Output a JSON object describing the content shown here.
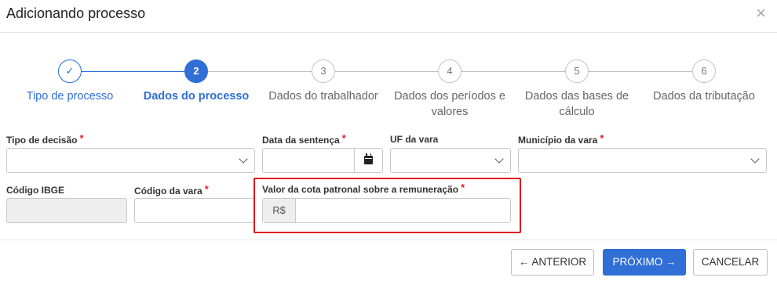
{
  "dialog": {
    "title": "Adicionando processo",
    "close_glyph": "×"
  },
  "steps": [
    {
      "number": "✓",
      "label": "Tipo de processo",
      "state": "done"
    },
    {
      "number": "2",
      "label": "Dados do processo",
      "state": "active"
    },
    {
      "number": "3",
      "label": "Dados do trabalhador",
      "state": "pending"
    },
    {
      "number": "4",
      "label": "Dados dos períodos e valores",
      "state": "pending"
    },
    {
      "number": "5",
      "label": "Dados das bases de cálculo",
      "state": "pending"
    },
    {
      "number": "6",
      "label": "Dados da tributação",
      "state": "pending"
    }
  ],
  "form": {
    "tipo_decisao": {
      "label": "Tipo de decisão",
      "required": "*",
      "value": ""
    },
    "data_sentenca": {
      "label": "Data da sentença",
      "required": "*",
      "value": ""
    },
    "uf_vara": {
      "label": "UF da vara",
      "value": ""
    },
    "municipio_vara": {
      "label": "Município da vara",
      "required": "*",
      "value": ""
    },
    "codigo_ibge": {
      "label": "Código IBGE",
      "value": ""
    },
    "codigo_vara": {
      "label": "Código da vara",
      "required": "*",
      "value": ""
    },
    "valor_cota": {
      "label": "Valor da cota patronal sobre a remuneração",
      "required": "*",
      "prefix": "R$",
      "value": ""
    }
  },
  "footer": {
    "anterior_label": "← ANTERIOR",
    "proximo_label": "PRÓXIMO →",
    "cancelar_label": "CANCELAR"
  },
  "colors": {
    "primary": "#2f6fd6",
    "required": "#d9232e",
    "highlight": "#e2141b"
  }
}
